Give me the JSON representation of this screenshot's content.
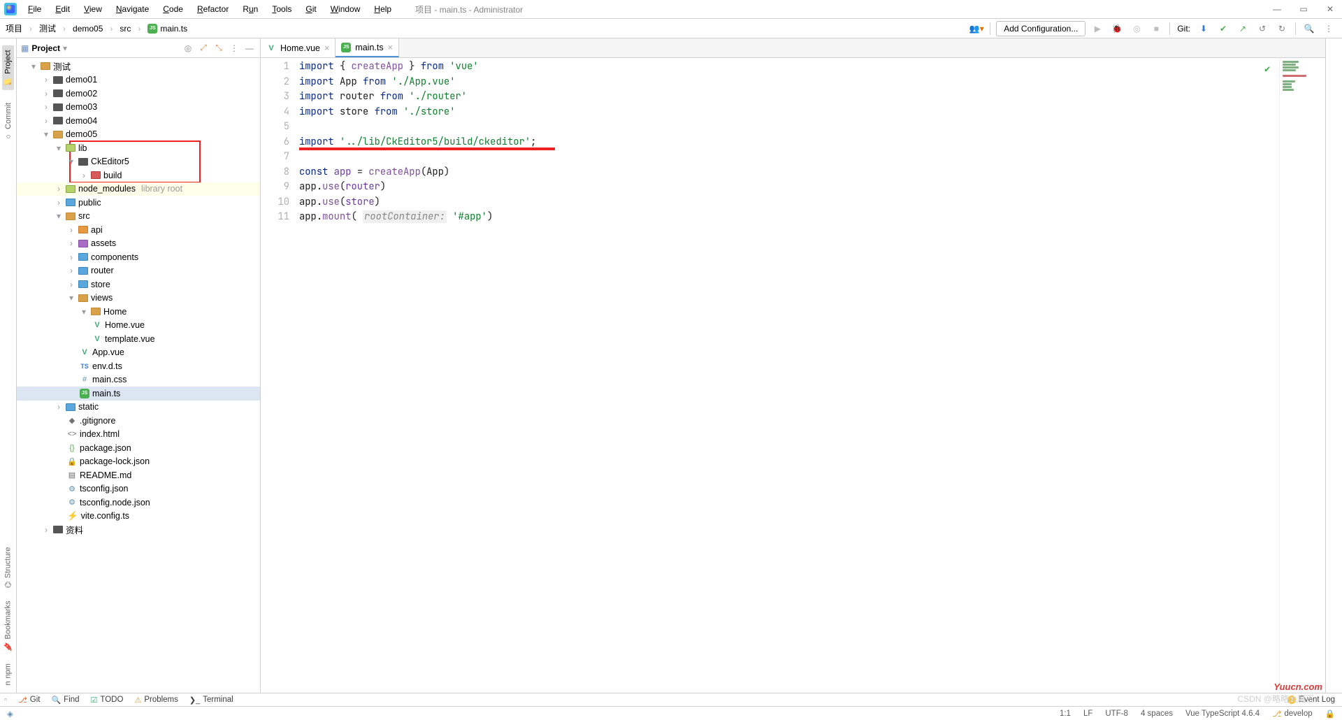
{
  "menu": [
    "File",
    "Edit",
    "View",
    "Navigate",
    "Code",
    "Refactor",
    "Run",
    "Tools",
    "Git",
    "Window",
    "Help"
  ],
  "window_title": "项目 - main.ts - Administrator",
  "breadcrumbs": {
    "parts": [
      "项目",
      "测试",
      "demo05",
      "src"
    ],
    "file": "main.ts"
  },
  "run": {
    "config": "Add Configuration...",
    "git_label": "Git:"
  },
  "left_tabs": {
    "project": "Project",
    "commit": "Commit",
    "structure": "Structure",
    "bookmarks": "Bookmarks",
    "npm": "npm"
  },
  "project_panel": {
    "title": "Project"
  },
  "tree": {
    "root": "测试",
    "demo": [
      "demo01",
      "demo02",
      "demo03",
      "demo04"
    ],
    "demo05": "demo05",
    "lib": "lib",
    "ckeditor": "CkEditor5",
    "build": "build",
    "node_modules": "node_modules",
    "node_modules_note": "library root",
    "public": "public",
    "src": "src",
    "api": "api",
    "assets": "assets",
    "components": "components",
    "router": "router",
    "store": "store",
    "views": "views",
    "home": "Home",
    "home_vue": "Home.vue",
    "template_vue": "template.vue",
    "app_vue": "App.vue",
    "envd": "env.d.ts",
    "maincss": "main.css",
    "maints": "main.ts",
    "static": "static",
    "gitignore": ".gitignore",
    "indexhtml": "index.html",
    "pkg": "package.json",
    "pkglock": "package-lock.json",
    "readme": "README.md",
    "tsconfig": "tsconfig.json",
    "tsconfignode": "tsconfig.node.json",
    "vite": "vite.config.ts",
    "ziliao": "资料"
  },
  "tabs": [
    {
      "label": "Home.vue",
      "kind": "vue"
    },
    {
      "label": "main.ts",
      "kind": "js",
      "active": true
    }
  ],
  "code": {
    "l1": {
      "a": "import",
      "b": " { ",
      "c": "createApp",
      "d": " } ",
      "e": "from",
      "f": " 'vue'"
    },
    "l2": {
      "a": "import",
      "b": " App ",
      "c": "from",
      "d": " './App.vue'"
    },
    "l3": {
      "a": "import",
      "b": " router ",
      "c": "from",
      "d": " './router'"
    },
    "l4": {
      "a": "import",
      "b": " store ",
      "c": "from",
      "d": " './store'"
    },
    "l6": {
      "a": "import",
      "b": " '../lib/CkEditor5/build/ckeditor'",
      "c": ";"
    },
    "l8": {
      "a": "const ",
      "b": "app",
      "c": " = ",
      "d": "createApp",
      "e": "(App)"
    },
    "l9": {
      "a": "app.",
      "b": "use",
      "c": "(",
      "d": "router",
      "e": ")"
    },
    "l10": {
      "a": "app.",
      "b": "use",
      "c": "(",
      "d": "store",
      "e": ")"
    },
    "l11": {
      "a": "app.",
      "b": "mount",
      "c": "( ",
      "hint": "rootContainer:",
      "d": " '#app'",
      "e": ")"
    }
  },
  "line_count": 11,
  "bottom_tools": {
    "git": "Git",
    "find": "Find",
    "todo": "TODO",
    "problems": "Problems",
    "terminal": "Terminal",
    "event_log": "Event Log",
    "event_count": "1"
  },
  "status": {
    "pos": "1:1",
    "le": "LF",
    "enc": "UTF-8",
    "indent": "4 spaces",
    "lang": "Vue TypeScript 4.6.4",
    "branch": "develop"
  },
  "watermark": {
    "yuucn": "Yuucn.com",
    "csdn": "CSDN @略略大魔王"
  }
}
